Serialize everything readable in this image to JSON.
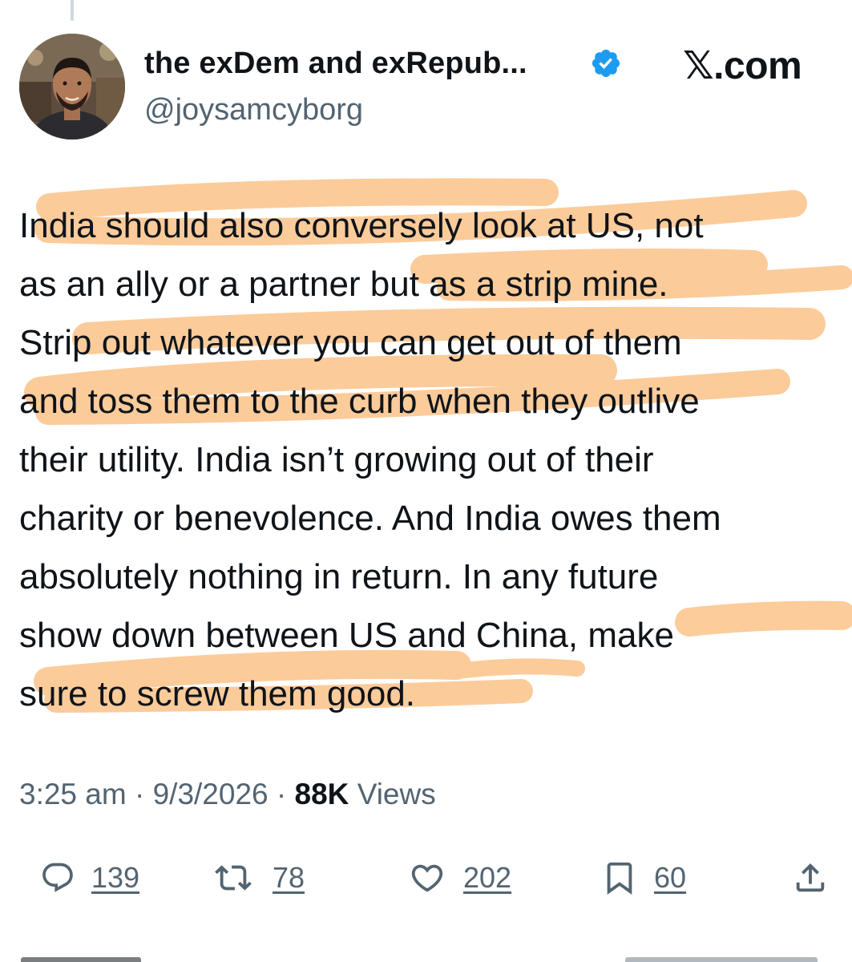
{
  "author": {
    "name": "the exDem and exRepub...",
    "handle": "@joysamcyborg"
  },
  "brand": "𝕏.com",
  "tweet": {
    "lines": [
      "India should also conversely look at US, not",
      "as an ally or a partner but as a strip mine.",
      "Strip out whatever you can get out of them",
      "and toss them to the curb when they outlive",
      "their utility. India isn’t growing out of their",
      "charity or benevolence. And India owes them",
      "absolutely nothing in return. In any future",
      "show down between US and China, make",
      "sure to screw them good."
    ],
    "highlight_color": "#fbb874"
  },
  "meta": {
    "time": "3:25 am",
    "date": "9/3/2026",
    "views_count": "88K",
    "views_label": "Views"
  },
  "actions": {
    "replies": "139",
    "reposts": "78",
    "likes": "202",
    "bookmarks": "60"
  },
  "colors": {
    "verified": "#1d9bf0",
    "text": "#0f1419",
    "secondary": "#536471"
  }
}
